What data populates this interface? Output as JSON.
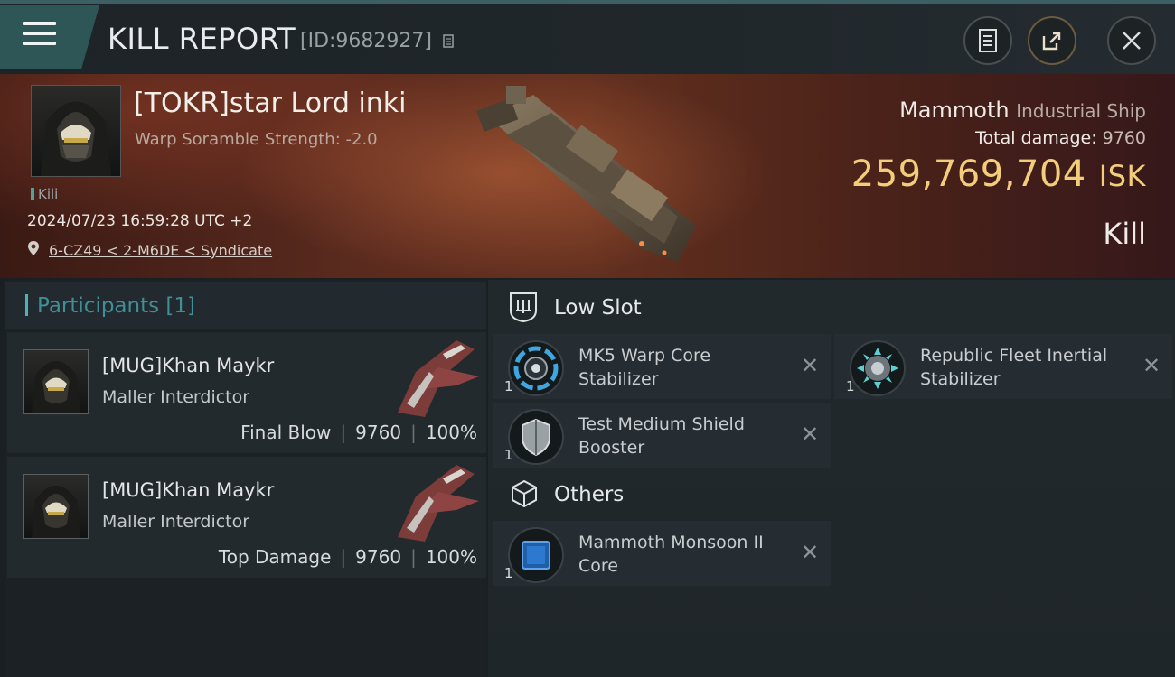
{
  "header": {
    "title": "KILL REPORT",
    "report_id": "[ID:9682927]"
  },
  "victim": {
    "name": "[TOKR]star Lord inki",
    "scramble": "Warp Soramble Strength: -2.0",
    "tag": "Kili",
    "datetime": "2024/07/23 16:59:28 UTC +2",
    "location": "6-CZ49 < 2-M6DE < Syndicate"
  },
  "ship": {
    "name": "Mammoth",
    "class": "Industrial Ship",
    "total_damage_label": "Total damage:",
    "total_damage": "9760",
    "isk_value": "259,769,704",
    "isk_unit": "ISK",
    "status": "Kill"
  },
  "participants": {
    "title": "Participants",
    "count": "[1]",
    "list": [
      {
        "name": "[MUG]Khan Maykr",
        "ship": "Maller Interdictor",
        "role": "Final Blow",
        "damage": "9760",
        "percent": "100%"
      },
      {
        "name": "[MUG]Khan Maykr",
        "ship": "Maller Interdictor",
        "role": "Top Damage",
        "damage": "9760",
        "percent": "100%"
      }
    ]
  },
  "low_slot": {
    "title": "Low Slot",
    "items": [
      {
        "qty": "1",
        "name_line1": "MK5 Warp Core",
        "name_line2": "Stabilizer",
        "icon": "warp-core-stabilizer-icon"
      },
      {
        "qty": "1",
        "name_line1": "Republic Fleet Inertial",
        "name_line2": "Stabilizer",
        "icon": "inertial-stabilizer-icon"
      },
      {
        "qty": "1",
        "name_line1": "Test Medium Shield",
        "name_line2": "Booster",
        "icon": "shield-booster-icon"
      }
    ]
  },
  "others": {
    "title": "Others",
    "items": [
      {
        "qty": "1",
        "name_line1": "Mammoth Monsoon II",
        "name_line2": "Core",
        "icon": "ship-core-icon"
      }
    ]
  },
  "colors": {
    "accent_teal": "#3f8f96",
    "isk_gold": "#f2cd7a"
  }
}
